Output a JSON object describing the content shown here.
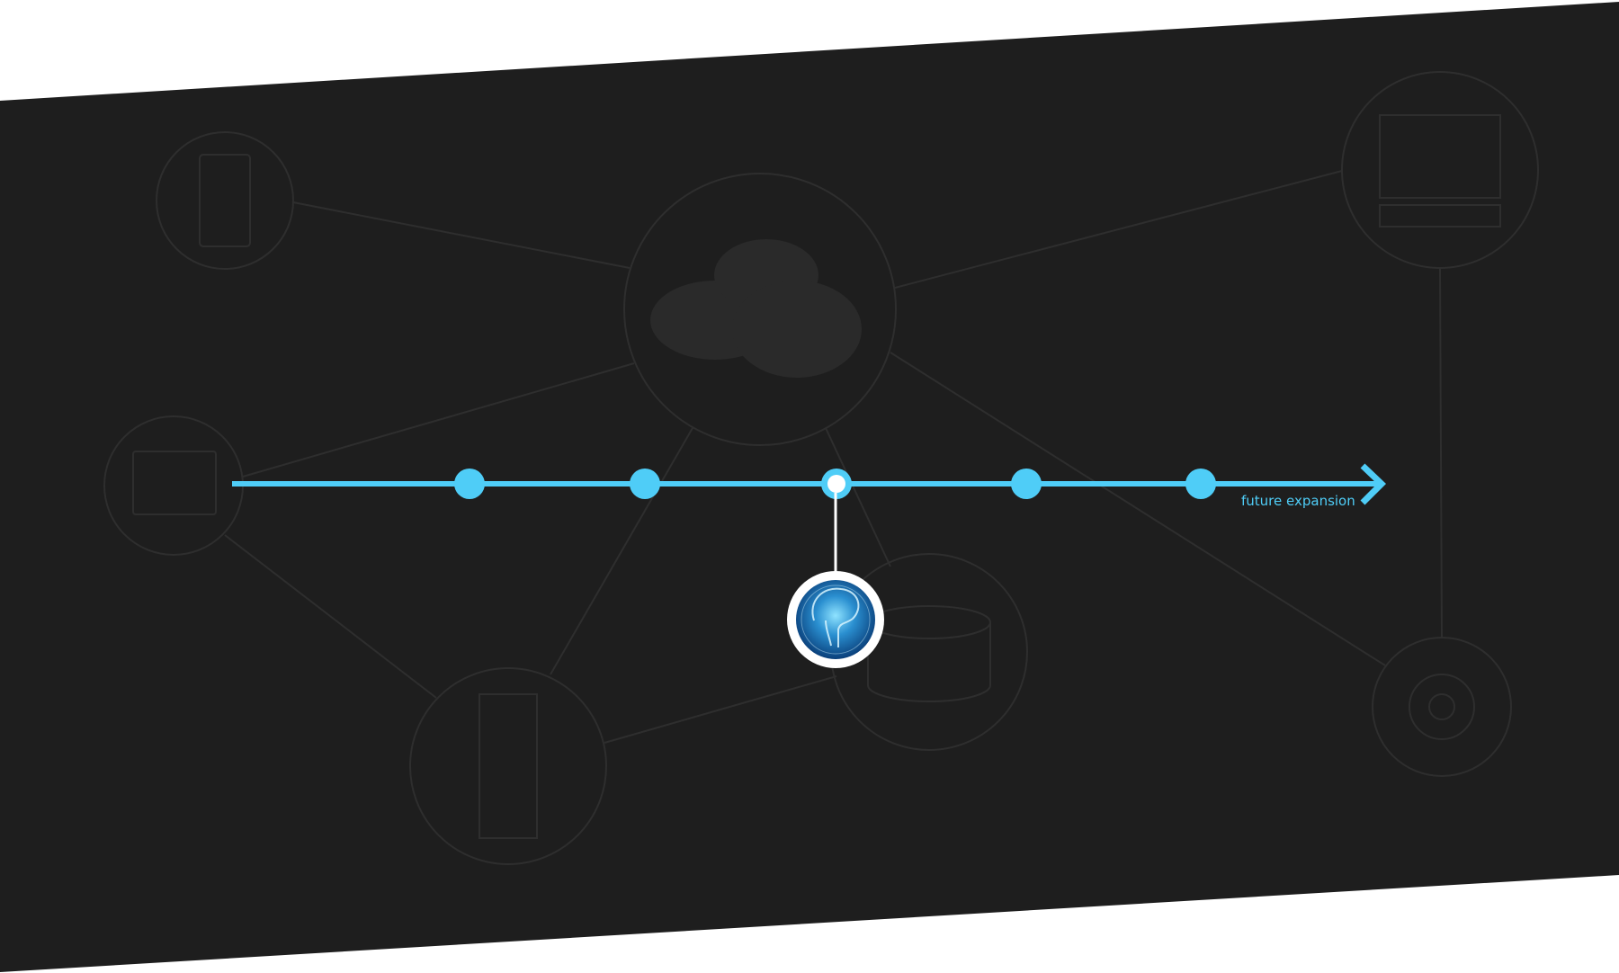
{
  "timeline": {
    "end_label": "future expansion",
    "milestone_count": 5,
    "active_milestone_index": 2,
    "featured_icon": "brain-circuit-icon"
  },
  "background_icons": [
    "phone-icon",
    "tablet-icon",
    "cloud-icon",
    "server-icon",
    "database-icon",
    "monitor-icon",
    "fan-icon"
  ],
  "colors": {
    "accent": "#4fcdf7",
    "band": "#1e1e1e",
    "node_line": "#2e2e2e",
    "white": "#ffffff"
  }
}
